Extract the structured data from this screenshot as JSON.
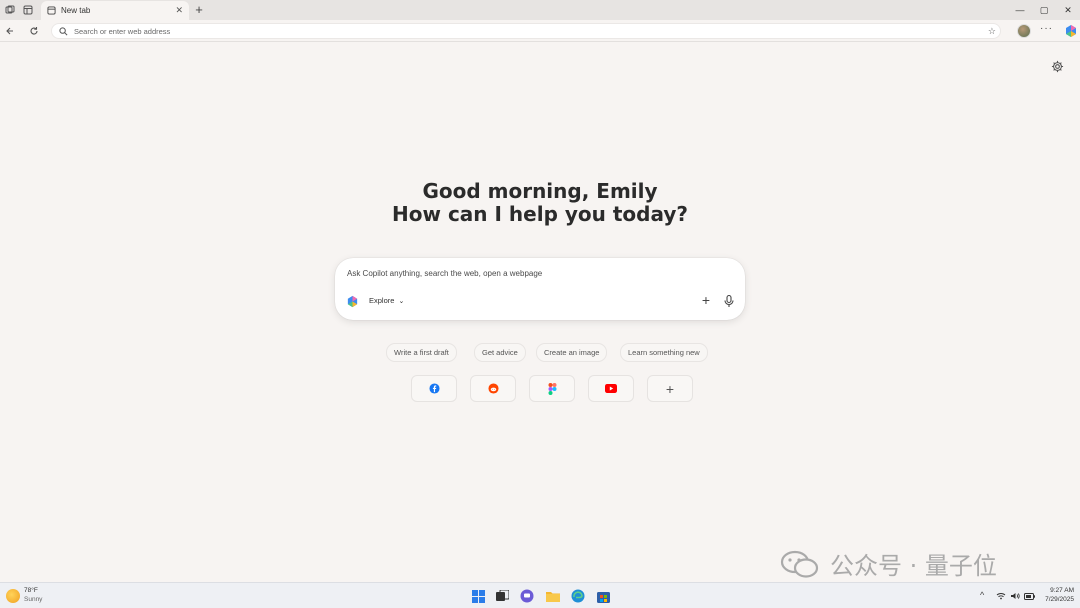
{
  "browser": {
    "tab": {
      "title": "New tab",
      "close": "✕"
    },
    "new_tab": "+",
    "window_controls": {
      "minimize": "—",
      "maximize": "▢",
      "close": "✕"
    },
    "address_placeholder": "Search or enter web address",
    "more": "···"
  },
  "main": {
    "greeting_line1": "Good morning, Emily",
    "greeting_line2": "How can I help you today?",
    "chat_placeholder": "Ask Copilot anything, search the web, open a webpage",
    "explore_label": "Explore",
    "suggestions": [
      "Write a first draft",
      "Get advice",
      "Create an image",
      "Learn something new"
    ],
    "quick_links": [
      {
        "icon": "facebook-icon",
        "color": "#1877f2"
      },
      {
        "icon": "reddit-icon",
        "color": "#ff4500"
      },
      {
        "icon": "figma-icon",
        "color": "#f24e1e"
      },
      {
        "icon": "youtube-icon",
        "color": "#ff0000"
      },
      {
        "icon": "add-shortcut-icon",
        "label": "+"
      }
    ]
  },
  "watermark": {
    "text": "公众号 · 量子位"
  },
  "taskbar": {
    "weather_temp": "78°F",
    "weather_condition": "Sunny",
    "time": "9:27 AM",
    "date": "7/29/2025",
    "tray_chevron": "^"
  }
}
